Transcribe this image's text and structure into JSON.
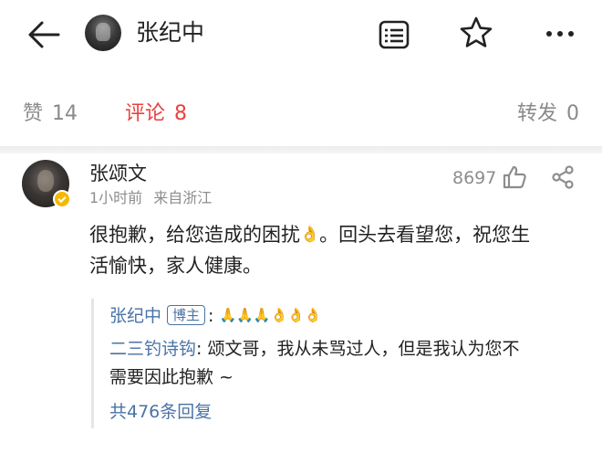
{
  "header": {
    "title": "张纪中",
    "icons": [
      "back-arrow-icon",
      "document-list-icon",
      "star-icon",
      "more-icon"
    ]
  },
  "tabs": [
    {
      "label": "赞",
      "count": "14"
    },
    {
      "label": "评论",
      "count": "8"
    },
    {
      "label": "转发",
      "count": "0"
    }
  ],
  "comment": {
    "author": "张颂文",
    "time": "1小时前",
    "source": "来自浙江",
    "likes": "8697",
    "text_line1": "很抱歉，给您造成的困扰",
    "text_line1_b": "。回头去看望您，祝您生",
    "text_line2": "活愉快，家人健康。",
    "emoji": "👌"
  },
  "replies": {
    "first_author": "张纪中",
    "first_badge": "博主",
    "first_colon": ":",
    "pray_emojis": "🙏🙏🙏",
    "ok_emojis": "👌👌👌",
    "second_author": "二三钓诗钩",
    "second_text_line1": ": 颂文哥，我从未骂过人，但是我认为您不",
    "second_text_line2": "需要因此抱歉 ~",
    "total": "共476条回复"
  },
  "colors": {
    "accent_red": "#e8423f",
    "link_blue": "#4a73a6",
    "muted_gray": "#8a8a8a"
  }
}
